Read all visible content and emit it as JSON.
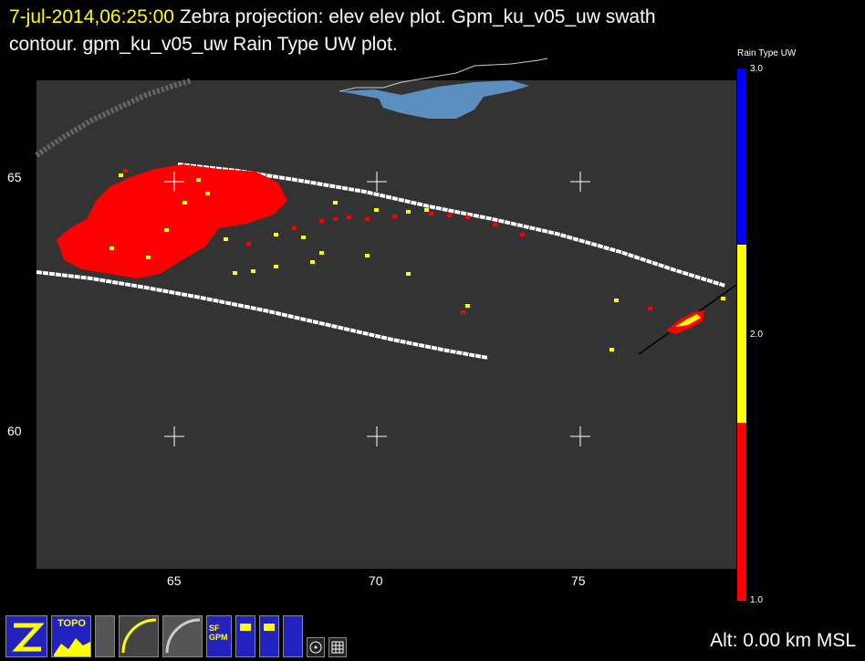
{
  "header": {
    "timestamp": "7-jul-2014,06:25:00",
    "line1_rest": " Zebra projection: elev elev  plot.  Gpm_ku_v05_uw swath",
    "line2": "contour.  gpm_ku_v05_uw Rain Type UW  plot."
  },
  "axes": {
    "x_ticks": [
      "65",
      "70",
      "75"
    ],
    "y_ticks": [
      "65",
      "60"
    ]
  },
  "colorbar": {
    "title": "Rain Type UW",
    "labels": [
      "3.0",
      "2.0",
      "1.0"
    ],
    "colors": [
      "#0000ff",
      "#ffff00",
      "#ff0000"
    ]
  },
  "colors": {
    "plot_bg": "#333333",
    "water": "#5b8fc0",
    "swath": "#ffffff",
    "rain_stratiform": "#ff0000",
    "rain_convective": "#ffff00"
  },
  "toolbar": {
    "icons": [
      "zebra-logo-icon",
      "topo-icon",
      "ir-icon",
      "gpm-ku-icon",
      "gpm-dpr-icon",
      "sfgpm-icon",
      "map-icon",
      "map2-icon",
      "bounds-icon",
      "target-icon",
      "grid-icon"
    ],
    "topo_label": "TOPO",
    "sf_label": "SF GPM"
  },
  "status": {
    "altitude": "Alt: 0.00 km MSL"
  }
}
